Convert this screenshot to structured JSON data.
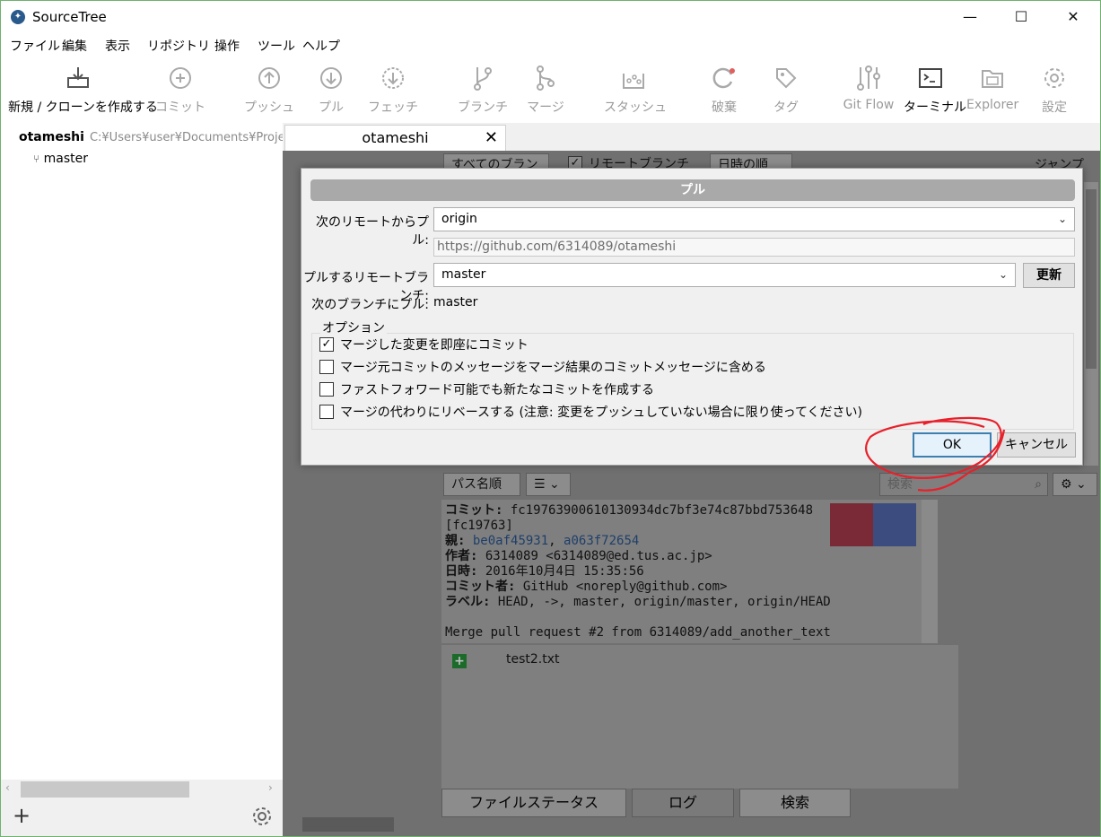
{
  "window": {
    "title": "SourceTree",
    "minimize": "—",
    "maximize": "☐",
    "close": "✕"
  },
  "menu": [
    "ファイル",
    "編集",
    "表示",
    "リポジトリ",
    "操作",
    "ツール",
    "ヘルプ"
  ],
  "toolbar": [
    {
      "label": "新規 / クローンを作成する",
      "icon": "clone-icon",
      "active": true
    },
    {
      "label": "コミット",
      "icon": "commit-icon"
    },
    {
      "label": "プッシュ",
      "icon": "push-icon"
    },
    {
      "label": "プル",
      "icon": "pull-icon"
    },
    {
      "label": "フェッチ",
      "icon": "fetch-icon"
    },
    {
      "label": "ブランチ",
      "icon": "branch-icon"
    },
    {
      "label": "マージ",
      "icon": "merge-icon"
    },
    {
      "label": "スタッシュ",
      "icon": "stash-icon"
    },
    {
      "label": "破棄",
      "icon": "discard-icon"
    },
    {
      "label": "タグ",
      "icon": "tag-icon"
    },
    {
      "label": "Git Flow",
      "icon": "gitflow-icon"
    },
    {
      "label": "ターミナル",
      "icon": "terminal-icon",
      "active": true
    },
    {
      "label": "Explorer",
      "icon": "folder-icon"
    },
    {
      "label": "設定",
      "icon": "settings-icon"
    }
  ],
  "sidebar": {
    "repo_name": "otameshi",
    "repo_path": "C:¥Users¥user¥Documents¥Projec",
    "branch": "master",
    "add": "+",
    "settings_icon": "gear-icon"
  },
  "tab": {
    "label": "otameshi",
    "close": "✕"
  },
  "background": {
    "branch_filter": "すべてのブランチ",
    "show_remote": "リモートブランチを表示",
    "sort_order": "日時の順",
    "jump_to": "ジャンプ先:",
    "path_sort": "パス名順",
    "search_placeholder": "検索"
  },
  "commit_details": {
    "commit_label": "コミット:",
    "commit_hash": "fc19763900610130934dc7bf3e74c87bbd753648",
    "short_hash": "[fc19763]",
    "parents_label": "親:",
    "parent1": "be0af45931",
    "parent2": "a063f72654",
    "author_label": "作者:",
    "author": "6314089 <6314089@ed.tus.ac.jp>",
    "date_label": "日時:",
    "date": "2016年10月4日 15:35:56",
    "committer_label": "コミット者:",
    "committer": "GitHub <noreply@github.com>",
    "labels_label": "ラベル:",
    "labels": "HEAD, ->, master, origin/master, origin/HEAD",
    "message": "Merge pull request #2 from 6314089/add_another_text"
  },
  "files": [
    {
      "name": "test2.txt",
      "status": "added"
    }
  ],
  "bottom_tabs": [
    "ファイルステータス",
    "ログ",
    "検索"
  ],
  "dialog": {
    "title": "プル",
    "remote_label": "次のリモートからプル:",
    "remote_value": "origin",
    "remote_url": "https://github.com/6314089/otameshi",
    "remote_branch_label": "プルするリモートブランチ:",
    "remote_branch_value": "master",
    "refresh_button": "更新",
    "local_branch_label": "次のブランチにプル:",
    "local_branch_value": "master",
    "options_legend": "オプション",
    "options": [
      {
        "label": "マージした変更を即座にコミット",
        "checked": true
      },
      {
        "label": "マージ元コミットのメッセージをマージ結果のコミットメッセージに含める",
        "checked": false
      },
      {
        "label": "ファストフォワード可能でも新たなコミットを作成する",
        "checked": false
      },
      {
        "label": "マージの代わりにリベースする (注意: 変更をプッシュしていない場合に限り使ってください)",
        "checked": false
      }
    ],
    "ok_button": "OK",
    "cancel_button": "キャンセル"
  },
  "colors": {
    "annotation": "#e8202a",
    "focus_border": "#3c7fb1",
    "dialog_title_bg": "#a9a9a9",
    "link": "#1f3f6a"
  }
}
